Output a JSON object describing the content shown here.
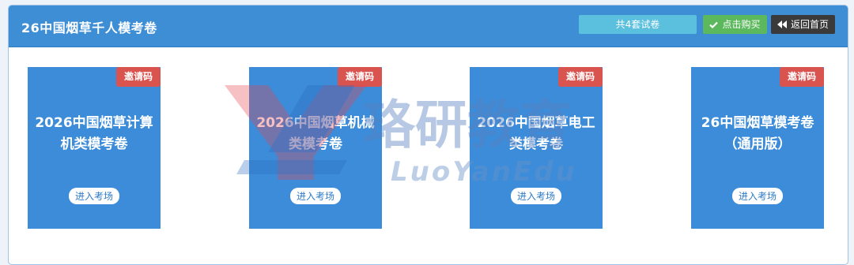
{
  "header": {
    "title": "26中国烟草千人模考卷",
    "count_label": "共4套试卷",
    "buy_label": "点击购买",
    "home_label": "返回首页"
  },
  "cards": [
    {
      "tag": "邀请码",
      "title": "2026中国烟草计算机类模考卷",
      "enter": "进入考场"
    },
    {
      "tag": "邀请码",
      "title": "2026中国烟草机械类模考卷",
      "enter": "进入考场"
    },
    {
      "tag": "邀请码",
      "title": "2026中国烟草电工类模考卷",
      "enter": "进入考场"
    },
    {
      "tag": "邀请码",
      "title": "26中国烟草模考卷（通用版）",
      "enter": "进入考场"
    }
  ],
  "watermark": {
    "brand_cn": "珞研教育",
    "brand_en": "LuoYanEdu"
  },
  "icons": {
    "buy": "check-icon",
    "home": "double-chevron-left-icon"
  },
  "colors": {
    "header": "#3e8ed6",
    "card": "#3c8cd9",
    "tag": "#d9534f",
    "buy": "#5cb85c",
    "home": "#3a3a3a",
    "count_badge": "#5bc0de"
  }
}
